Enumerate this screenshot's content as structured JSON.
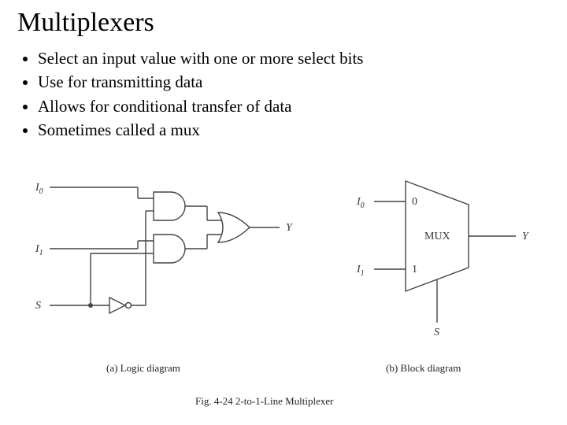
{
  "title": "Multiplexers",
  "bullets": [
    "Select an input value with one or more select bits",
    "Use for transmitting data",
    "Allows for conditional transfer of data",
    "Sometimes called a mux"
  ],
  "figure": {
    "caption_a": "(a) Logic diagram",
    "caption_b": "(b) Block diagram",
    "title": "Fig. 4-24  2-to-1-Line Multiplexer",
    "labels": {
      "I0": "I",
      "I0_sub": "0",
      "I1": "I",
      "I1_sub": "1",
      "S": "S",
      "Y": "Y",
      "MUX": "MUX",
      "zero": "0",
      "one": "1"
    }
  }
}
